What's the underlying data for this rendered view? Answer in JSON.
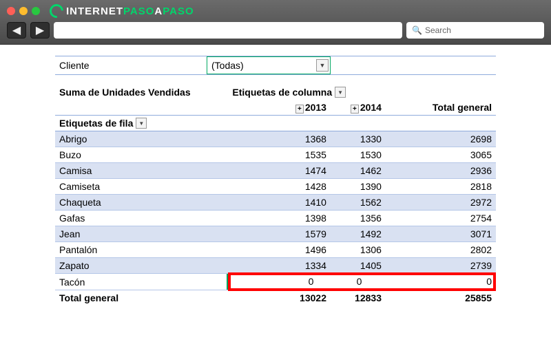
{
  "header": {
    "brand_white1": "INTERNET",
    "brand_green": "PASO",
    "brand_white2": "A",
    "brand_green2": "PASO",
    "search_placeholder": "Search"
  },
  "pivot": {
    "filter_label": "Cliente",
    "filter_value": "(Todas)",
    "value_field": "Suma de Unidades Vendidas",
    "col_field": "Etiquetas de columna",
    "row_field": "Etiquetas de fila",
    "years": {
      "y1": "2013",
      "y2": "2014"
    },
    "grand_label": "Total general"
  },
  "rows": [
    {
      "name": "Abrigo",
      "y1": "1368",
      "y2": "1330",
      "total": "2698"
    },
    {
      "name": "Buzo",
      "y1": "1535",
      "y2": "1530",
      "total": "3065"
    },
    {
      "name": "Camisa",
      "y1": "1474",
      "y2": "1462",
      "total": "2936"
    },
    {
      "name": "Camiseta",
      "y1": "1428",
      "y2": "1390",
      "total": "2818"
    },
    {
      "name": "Chaqueta",
      "y1": "1410",
      "y2": "1562",
      "total": "2972"
    },
    {
      "name": "Gafas",
      "y1": "1398",
      "y2": "1356",
      "total": "2754"
    },
    {
      "name": "Jean",
      "y1": "1579",
      "y2": "1492",
      "total": "3071"
    },
    {
      "name": "Pantalón",
      "y1": "1496",
      "y2": "1306",
      "total": "2802"
    },
    {
      "name": "Zapato",
      "y1": "1334",
      "y2": "1405",
      "total": "2739"
    }
  ],
  "highlight": {
    "name": "Tacón",
    "y1": "0",
    "y2": "0",
    "total": "0"
  },
  "totals": {
    "y1": "13022",
    "y2": "12833",
    "total": "25855"
  },
  "chart_data": {
    "type": "table",
    "title": "Suma de Unidades Vendidas",
    "columns": [
      "Etiquetas de fila",
      "2013",
      "2014",
      "Total general"
    ],
    "rows": [
      [
        "Abrigo",
        1368,
        1330,
        2698
      ],
      [
        "Buzo",
        1535,
        1530,
        3065
      ],
      [
        "Camisa",
        1474,
        1462,
        2936
      ],
      [
        "Camiseta",
        1428,
        1390,
        2818
      ],
      [
        "Chaqueta",
        1410,
        1562,
        2972
      ],
      [
        "Gafas",
        1398,
        1356,
        2754
      ],
      [
        "Jean",
        1579,
        1492,
        3071
      ],
      [
        "Pantalón",
        1496,
        1306,
        2802
      ],
      [
        "Zapato",
        1334,
        1405,
        2739
      ],
      [
        "Tacón",
        0,
        0,
        0
      ]
    ],
    "grand_total": [
      "Total general",
      13022,
      12833,
      25855
    ],
    "filter": {
      "Cliente": "(Todas)"
    }
  }
}
